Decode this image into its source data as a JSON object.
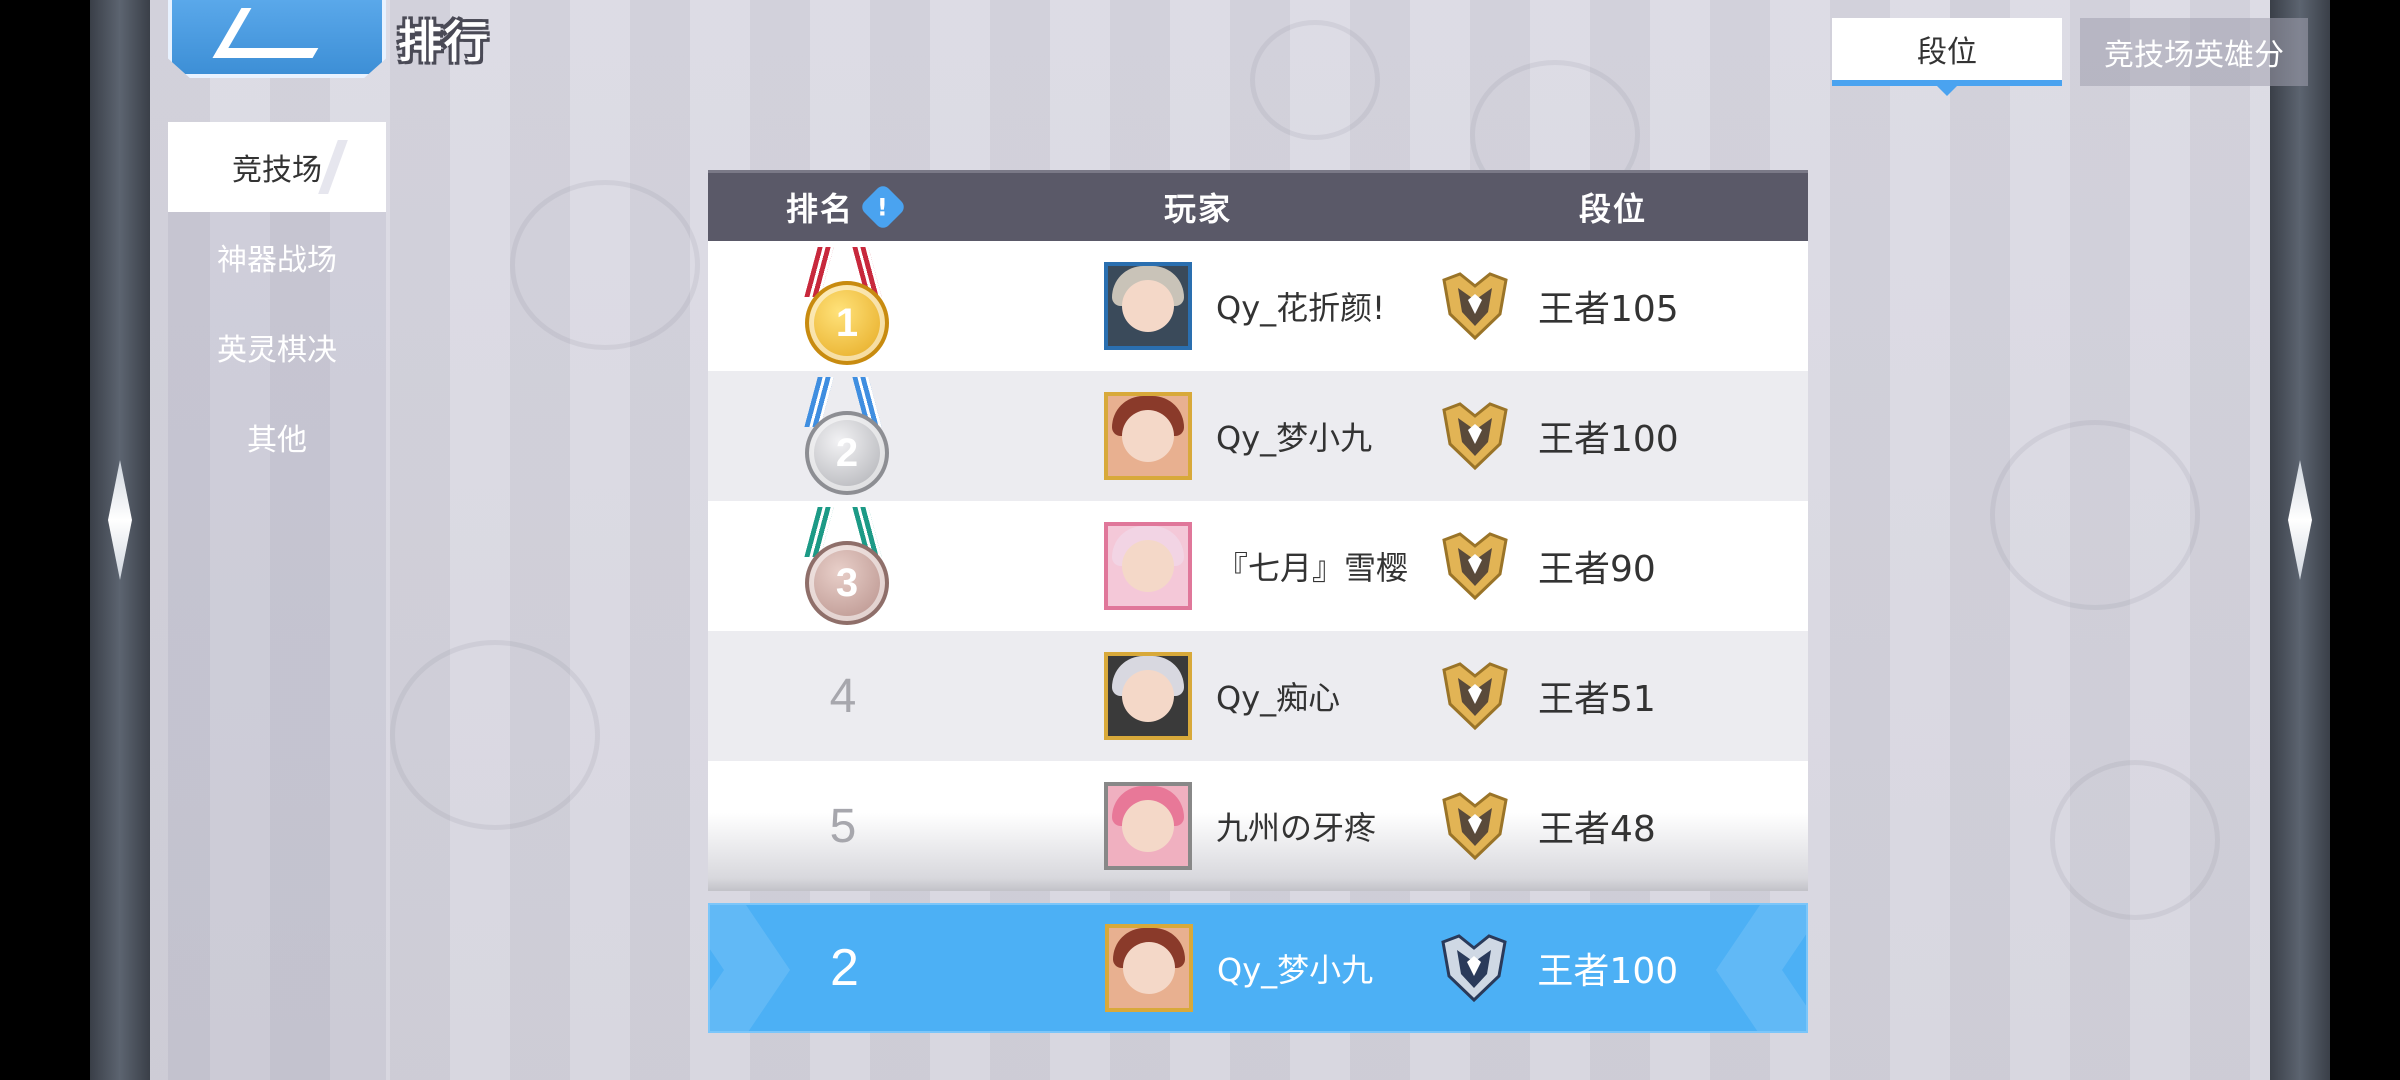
{
  "header": {
    "title": "排行"
  },
  "menu": {
    "items": [
      {
        "label": "竞技场",
        "active": true
      },
      {
        "label": "神器战场",
        "active": false
      },
      {
        "label": "英灵棋决",
        "active": false
      },
      {
        "label": "其他",
        "active": false
      }
    ]
  },
  "tabs": [
    {
      "label": "段位",
      "active": true
    },
    {
      "label": "竞技场英雄分",
      "active": false
    }
  ],
  "table": {
    "headers": {
      "rank": "排名",
      "player": "玩家",
      "tier": "段位"
    },
    "rows": [
      {
        "rank": "1",
        "medal": "gold",
        "player": "Qy_花折颜!",
        "tier": "王者105"
      },
      {
        "rank": "2",
        "medal": "silver",
        "player": "Qy_梦小九",
        "tier": "王者100"
      },
      {
        "rank": "3",
        "medal": "bronze",
        "player": "『七月』雪樱",
        "tier": "王者90"
      },
      {
        "rank": "4",
        "medal": "",
        "player": "Qy_痴心",
        "tier": "王者51"
      },
      {
        "rank": "5",
        "medal": "",
        "player": "九州の牙疼",
        "tier": "王者48"
      }
    ],
    "self": {
      "rank": "2",
      "player": "Qy_梦小九",
      "tier": "王者100"
    }
  },
  "colors": {
    "accent": "#4cb0f5",
    "header_bg": "#5a5968",
    "gold": "#e3a41a"
  }
}
